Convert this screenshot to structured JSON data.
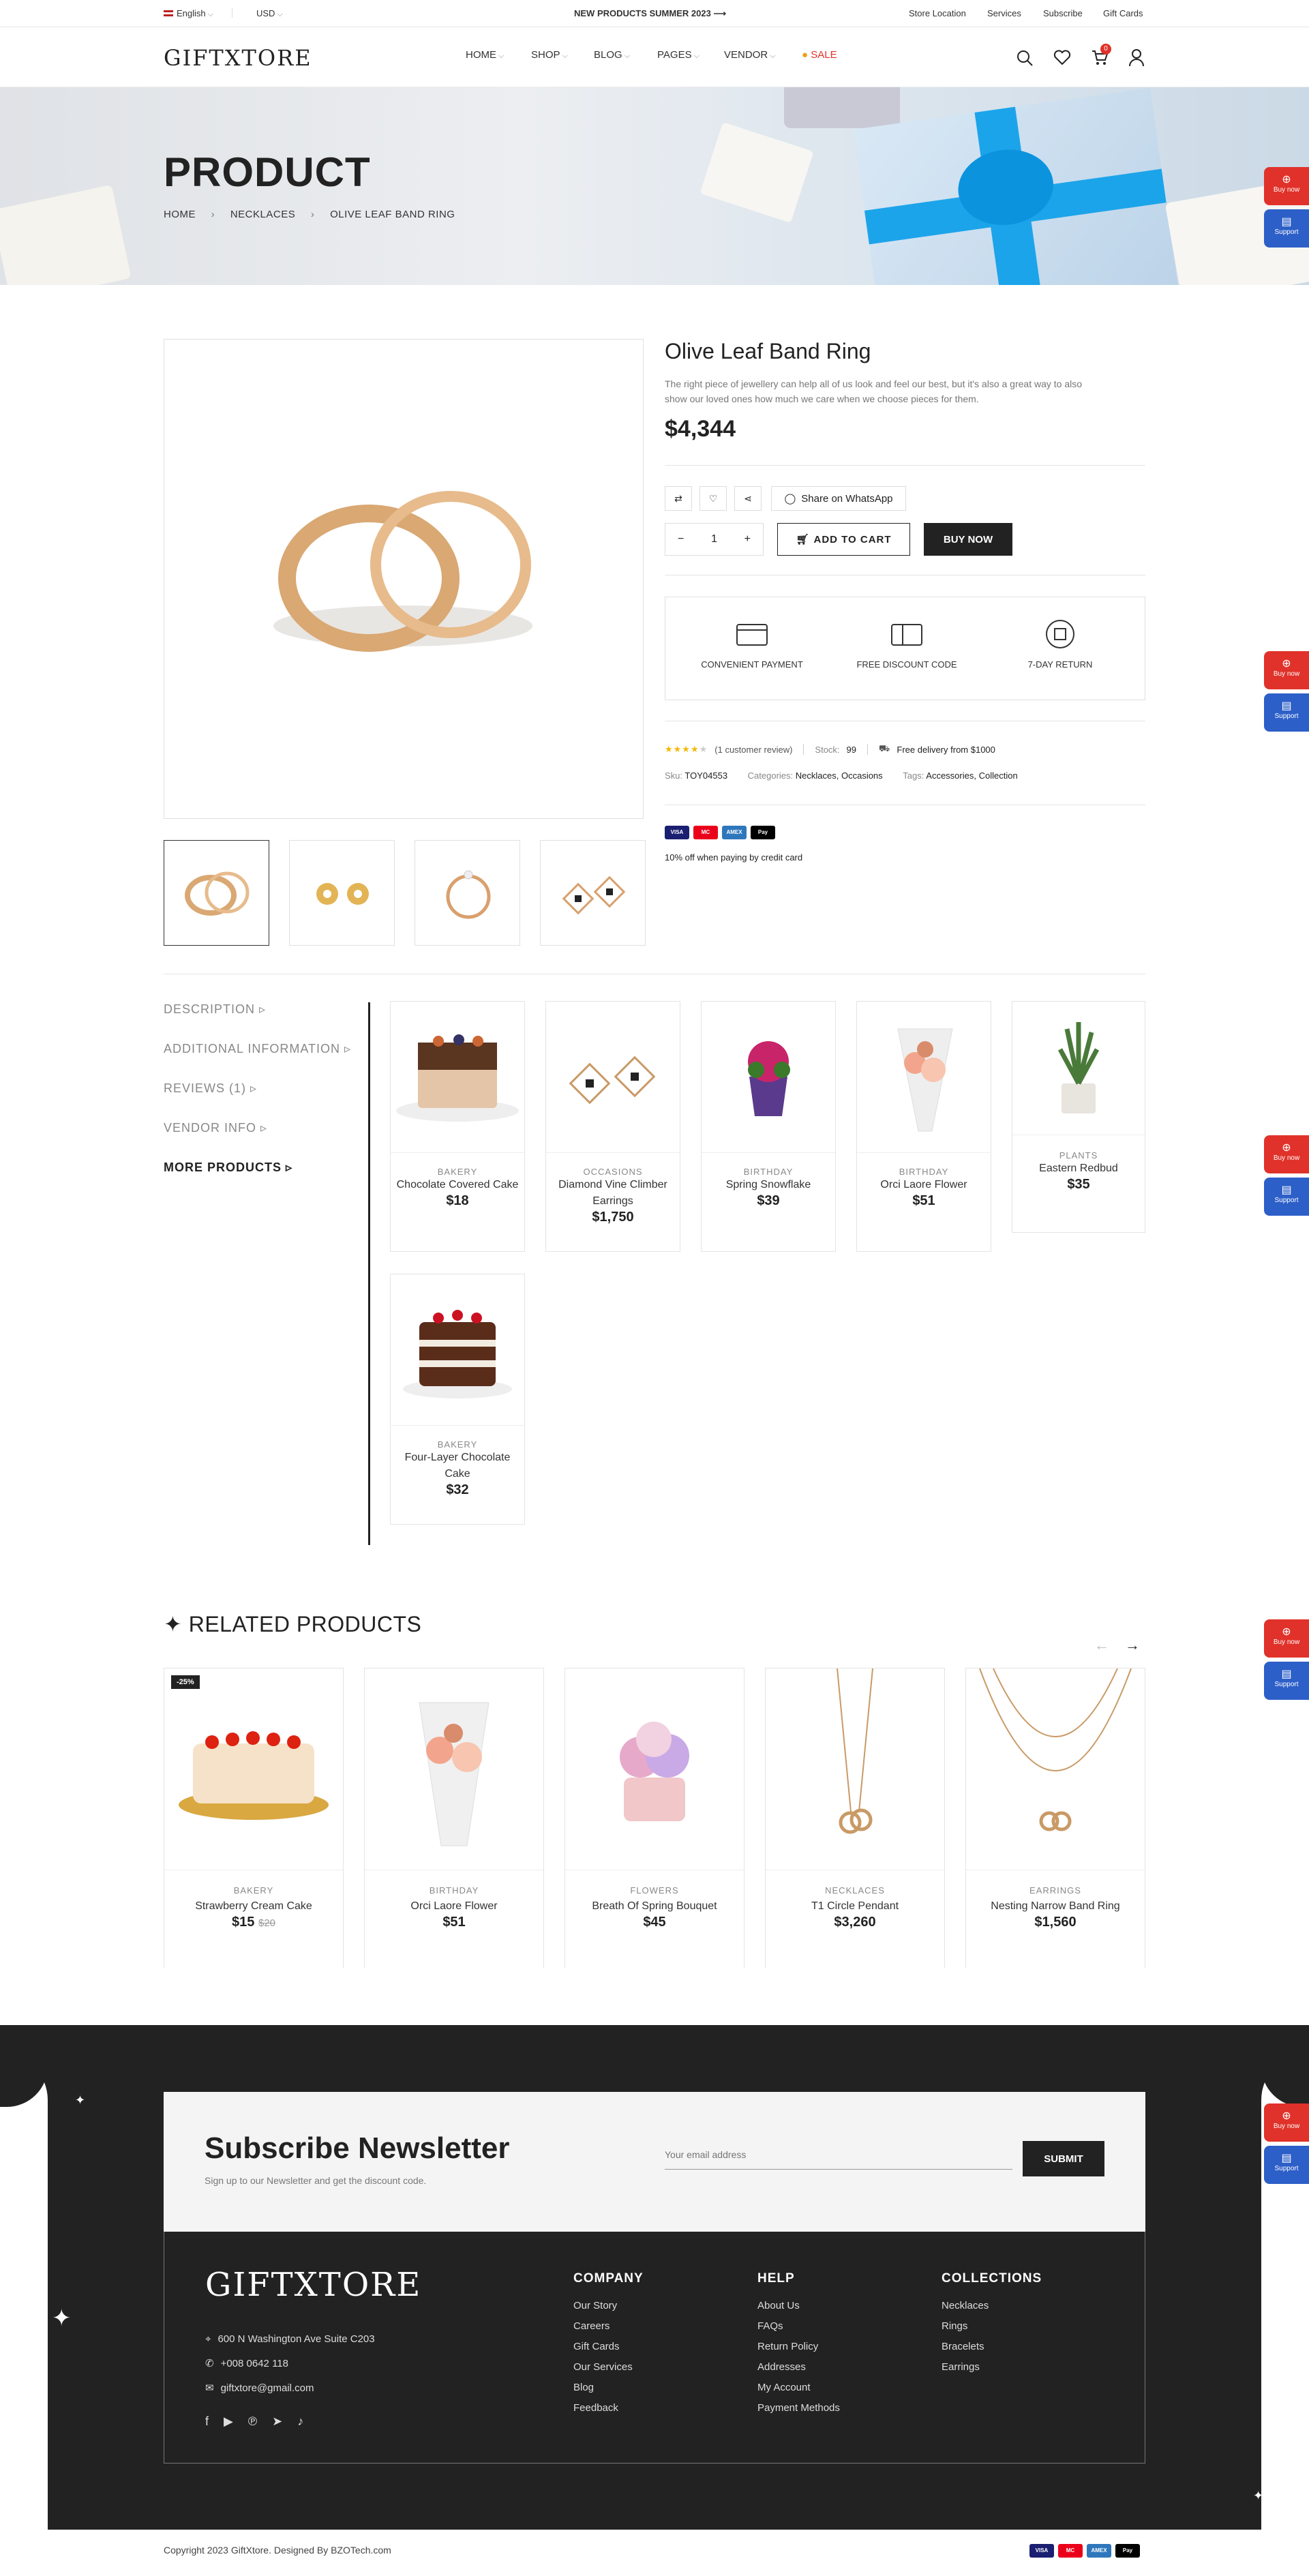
{
  "topbar": {
    "language": "English",
    "currency": "USD",
    "promo": "NEW PRODUCTS SUMMER 2023",
    "links": [
      "Store Location",
      "Services",
      "Subscribe",
      "Gift Cards"
    ]
  },
  "header": {
    "logo": "GIFTXTORE",
    "nav": [
      "HOME",
      "SHOP",
      "BLOG",
      "PAGES",
      "VENDOR",
      "SALE"
    ],
    "cart_count": "0"
  },
  "banner": {
    "title": "PRODUCT",
    "breadcrumb": [
      "HOME",
      "NECKLACES",
      "OLIVE LEAF BAND RING"
    ]
  },
  "product": {
    "name": "Olive Leaf Band Ring",
    "desc1": "The right piece of jewellery can help all of us look and feel our best, but it's also a great way to also",
    "desc2": "show our loved ones how much we care when we choose pieces for them.",
    "price": "$4,344",
    "share_label": "Share on WhatsApp",
    "qty": "1",
    "add_to_cart": "ADD TO CART",
    "buy_now": "BUY NOW",
    "features": [
      "CONVENIENT PAYMENT",
      "FREE DISCOUNT CODE",
      "7-DAY RETURN"
    ],
    "rating": 4,
    "review_text": "(1 customer review)",
    "stock_label": "Stock:",
    "stock": "99",
    "delivery": "Free delivery from $1000",
    "sku_label": "Sku:",
    "sku": "TOY04553",
    "categories_label": "Categories:",
    "categories": "Necklaces, Occasions",
    "tags_label": "Tags:",
    "tags": "Accessories, Collection",
    "pay_note": "10% off when paying by credit card"
  },
  "payments": [
    "VISA",
    "MC",
    "AMEX",
    "Pay"
  ],
  "tabs": [
    "DESCRIPTION",
    "ADDITIONAL INFORMATION",
    "REVIEWS (1)",
    "VENDOR INFO",
    "MORE PRODUCTS"
  ],
  "more_products": [
    {
      "cat": "BAKERY",
      "name": "Chocolate Covered Cake",
      "price": "$18"
    },
    {
      "cat": "OCCASIONS",
      "name": "Diamond Vine Climber Earrings",
      "price": "$1,750"
    },
    {
      "cat": "BIRTHDAY",
      "name": "Spring Snowflake",
      "price": "$39"
    },
    {
      "cat": "BIRTHDAY",
      "name": "Orci Laore Flower",
      "price": "$51"
    },
    {
      "cat": "PLANTS",
      "name": "Eastern Redbud",
      "price": "$35"
    },
    {
      "cat": "BAKERY",
      "name": "Four-Layer Chocolate Cake",
      "price": "$32"
    }
  ],
  "related": {
    "title": "RELATED PRODUCTS",
    "items": [
      {
        "cat": "BAKERY",
        "name": "Strawberry Cream Cake",
        "price": "$15",
        "old": "$20",
        "badge": "-25%"
      },
      {
        "cat": "BIRTHDAY",
        "name": "Orci Laore Flower",
        "price": "$51"
      },
      {
        "cat": "FLOWERS",
        "name": "Breath Of Spring Bouquet",
        "price": "$45"
      },
      {
        "cat": "NECKLACES",
        "name": "T1 Circle Pendant",
        "price": "$3,260"
      },
      {
        "cat": "EARRINGS",
        "name": "Nesting Narrow Band Ring",
        "price": "$1,560"
      }
    ]
  },
  "side": {
    "buy": "Buy now",
    "support": "Support"
  },
  "newsletter": {
    "title": "Subscribe Newsletter",
    "sub": "Sign up to our Newsletter and get the discount code.",
    "placeholder": "Your email address",
    "submit": "SUBMIT"
  },
  "footer": {
    "logo": "GIFTXTORE",
    "address": "600 N Washington Ave Suite C203",
    "phone": "+008 0642 118",
    "email": "giftxtore@gmail.com",
    "company": {
      "title": "COMPANY",
      "links": [
        "Our Story",
        "Careers",
        "Gift Cards",
        "Our Services",
        "Blog",
        "Feedback"
      ]
    },
    "help": {
      "title": "HELP",
      "links": [
        "About Us",
        "FAQs",
        "Return Policy",
        "Addresses",
        "My Account",
        "Payment Methods"
      ]
    },
    "collections": {
      "title": "COLLECTIONS",
      "links": [
        "Necklaces",
        "Rings",
        "Bracelets",
        "Earrings"
      ]
    },
    "copyright": "Copyright 2023 GiftXtore. Designed By BZOTech.com"
  },
  "colors": {
    "accent": "#222222",
    "sale": "#e0322a",
    "star": "#f5b800",
    "support": "#2d5fc8"
  }
}
